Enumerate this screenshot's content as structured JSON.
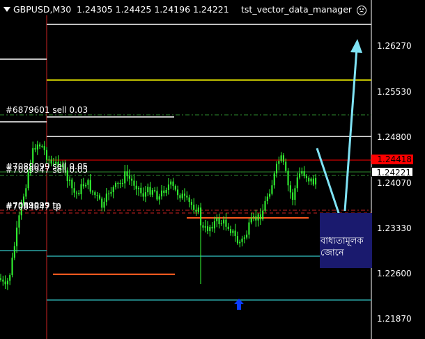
{
  "header": {
    "symbol": "GBPUSD,M30",
    "ohlc": "1.24305 1.24425 1.24196 1.24221",
    "ea_name": "tst_vector_data_manager",
    "ea_status_icon": "sad-face-icon"
  },
  "price_axis": {
    "ticks": [
      "1.26270",
      "1.25530",
      "1.24800",
      "1.24070",
      "1.23330",
      "1.22600",
      "1.21870"
    ]
  },
  "price_boxes": {
    "ask_level": "1.24418",
    "bid_current": "1.24221"
  },
  "order_labels": {
    "sell_order": "#6879601 sell 0.03",
    "overlap_order_a": "#7089099 sell 0.05",
    "overlap_order_b": "#7089947 sell 0.05",
    "tp_label_a": "#7089099 tp",
    "tp_label_b": "#7084847 tp"
  },
  "zone": {
    "label": "বাধ্যতামূলক জোনে"
  },
  "colors": {
    "background": "#000000",
    "candle": "#33ff33",
    "resistance": "#ffff00",
    "support_teal": "#2aa6a6",
    "tp_line": "#ff5a1f",
    "ask_line": "#ff0000",
    "annotation_arrow": "#7fe3f5",
    "zone_fill": "#1a1a6e",
    "buy_arrow": "#0a3cff"
  }
}
